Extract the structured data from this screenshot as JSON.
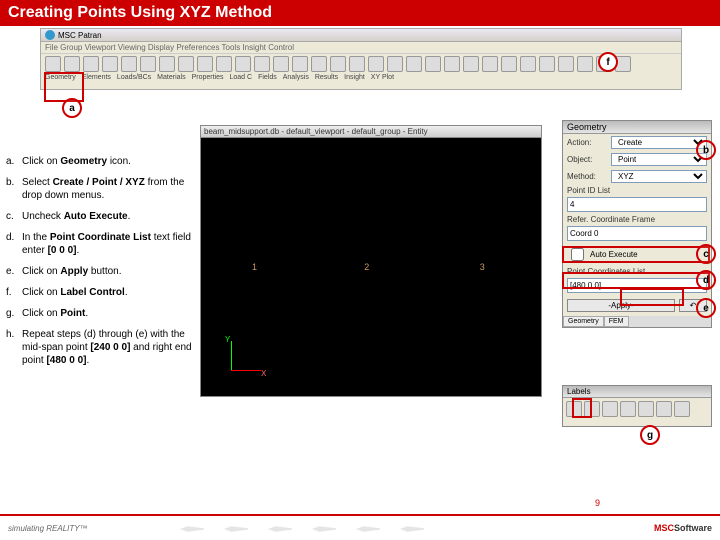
{
  "title": "Creating Points Using XYZ Method",
  "app_title": "MSC Patran",
  "toolbar": {
    "menus": "File  Group  Viewport  Viewing  Display  Preferences  Tools  Insight  Control",
    "tool_labels": [
      "Geometry",
      "Elements",
      "Loads/BCs",
      "Materials",
      "Properties",
      "Load C",
      "Fields",
      "Analysis",
      "Results",
      "Insight",
      "XY Plot"
    ]
  },
  "steps": [
    {
      "l": "a.",
      "t": "Click on <b>Geometry</b> icon."
    },
    {
      "l": "b.",
      "t": "Select <b>Create / Point / XYZ</b> from the drop down menus."
    },
    {
      "l": "c.",
      "t": "Uncheck <b>Auto Execute</b>."
    },
    {
      "l": "d.",
      "t": "In the <b>Point Coordinate List</b> text field enter <b>[0 0 0]</b>."
    },
    {
      "l": "e.",
      "t": "Click on <b>Apply</b> button."
    },
    {
      "l": "f.",
      "t": "Click on <b>Label Control</b>."
    },
    {
      "l": "g.",
      "t": "Click on <b>Point</b>."
    },
    {
      "l": "h.",
      "t": "Repeat steps (d) through (e) with the mid-span point <b>[240 0 0]</b> and right end point <b>[480 0 0]</b>."
    }
  ],
  "viewport": {
    "title": "beam_midsupport.db - default_viewport - default_group - Entity",
    "points": [
      "1",
      "2",
      "3"
    ],
    "axes": {
      "x": "X",
      "y": "Y"
    }
  },
  "geom": {
    "title": "Geometry",
    "action_l": "Action:",
    "action_v": "Create",
    "object_l": "Object:",
    "object_v": "Point",
    "method_l": "Method:",
    "method_v": "XYZ",
    "pid_l": "Point ID List",
    "pid_v": "4",
    "rcf_l": "Refer. Coordinate Frame",
    "rcf_v": "Coord 0",
    "ae_l": "Auto Execute",
    "pcl_l": "Point Coordinates List",
    "pcl_v": "[480 0 0]",
    "apply": "-Apply-",
    "tabs": [
      "Geometry",
      "FEM"
    ]
  },
  "labels_panel": {
    "title": "Labels"
  },
  "callouts": {
    "a": "a",
    "b": "b",
    "c": "c",
    "d": "d",
    "e": "e",
    "f": "f",
    "g": "g"
  },
  "footer": {
    "left": "simulating REALITY™",
    "right_msc": "MSC",
    "right_soft": "Software",
    "page": "9"
  }
}
